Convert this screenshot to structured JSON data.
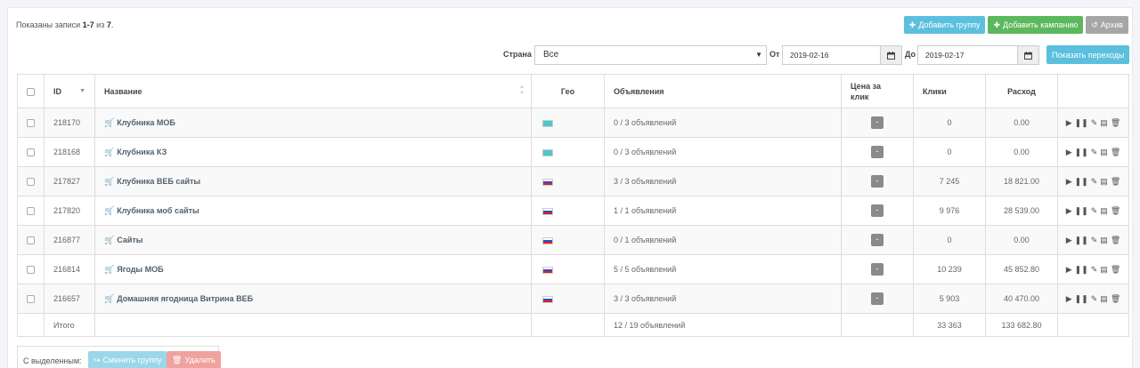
{
  "summary": {
    "prefix": "Показаны записи ",
    "range": "1-7",
    "mid": " из ",
    "total": "7",
    "suffix": "."
  },
  "toolbar": {
    "add_group": "Добавить группу",
    "add_campaign": "Добавить кампанию",
    "archive": "Архив"
  },
  "filters": {
    "country_label": "Страна",
    "country_value": "Все",
    "from_label": "От",
    "from_value": "2019-02-16",
    "to_label": "До",
    "to_value": "2019-02-17",
    "show_button": "Показать переходы"
  },
  "table": {
    "headers": {
      "id": "ID",
      "name": "Название",
      "geo": "Гео",
      "ads": "Объявления",
      "cpc_line1": "Цена за",
      "cpc_line2": "клик",
      "clicks": "Клики",
      "cost": "Расход"
    },
    "rows": [
      {
        "id": "218170",
        "name": "Клубника МОБ",
        "geo": "kz",
        "ads": "0 / 3 объявлений",
        "cpc": "-",
        "clicks": "0",
        "cost": "0.00"
      },
      {
        "id": "218168",
        "name": "Клубника КЗ",
        "geo": "kz",
        "ads": "0 / 3 объявлений",
        "cpc": "-",
        "clicks": "0",
        "cost": "0.00"
      },
      {
        "id": "217827",
        "name": "Клубника ВЕБ сайты",
        "geo": "ru",
        "ads": "3 / 3 объявлений",
        "cpc": "-",
        "clicks": "7 245",
        "cost": "18 821.00"
      },
      {
        "id": "217820",
        "name": "Клубника моб сайты",
        "geo": "ru",
        "ads": "1 / 1 объявлений",
        "cpc": "-",
        "clicks": "9 976",
        "cost": "28 539.00"
      },
      {
        "id": "216877",
        "name": "Сайты",
        "geo": "ru",
        "ads": "0 / 1 объявлений",
        "cpc": "-",
        "clicks": "0",
        "cost": "0.00"
      },
      {
        "id": "216814",
        "name": "Ягоды МОБ",
        "geo": "ru",
        "ads": "5 / 5 объявлений",
        "cpc": "-",
        "clicks": "10 239",
        "cost": "45 852.80"
      },
      {
        "id": "216657",
        "name": "Домашняя ягодница Витрина ВЕБ",
        "geo": "ru",
        "ads": "3 / 3 объявлений",
        "cpc": "-",
        "clicks": "5 903",
        "cost": "40 470.00"
      }
    ],
    "footer": {
      "label": "Итого",
      "ads": "12 / 19 объявлений",
      "clicks": "33 363",
      "cost": "133 682.80"
    }
  },
  "bulk": {
    "label": "С выделенным:",
    "change_group": "Сменить группу",
    "delete": "Удалить"
  },
  "colors": {
    "info": "#5bc0de",
    "success": "#5cb85c",
    "gray": "#a6a6a6",
    "flag_kz": "#4fc5c5"
  }
}
